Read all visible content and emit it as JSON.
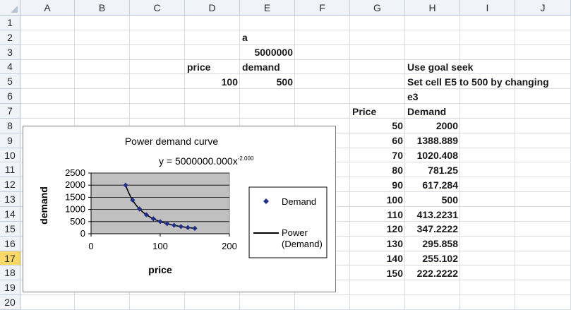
{
  "columns": [
    "A",
    "B",
    "C",
    "D",
    "E",
    "F",
    "G",
    "H",
    "I",
    "J"
  ],
  "rows": [
    "1",
    "2",
    "3",
    "4",
    "5",
    "6",
    "7",
    "8",
    "9",
    "10",
    "11",
    "12",
    "13",
    "14",
    "15",
    "16",
    "17",
    "18",
    "19",
    "20"
  ],
  "cells": {
    "E2": "a",
    "E3": "5000000",
    "D4": "price",
    "E4": "demand",
    "D5": "100",
    "E5": "500",
    "H4": "Use goal seek",
    "H5": "Set cell E5 to 500 by changing",
    "H6": "e3",
    "G7": "Price",
    "H7": "Demand"
  },
  "table": {
    "prices": [
      "50",
      "60",
      "70",
      "80",
      "90",
      "100",
      "110",
      "120",
      "130",
      "140",
      "150"
    ],
    "demands": [
      "2000",
      "1388.889",
      "1020.408",
      "781.25",
      "617.284",
      "500",
      "413.2231",
      "347.2222",
      "295.858",
      "255.102",
      "222.2222"
    ]
  },
  "chart_data": {
    "type": "scatter",
    "title": "Power demand curve",
    "equation_base": "y = 5000000.000x",
    "equation_exp": "-2.000",
    "xlabel": "price",
    "ylabel": "demand",
    "xlim": [
      0,
      200
    ],
    "ylim": [
      0,
      2500
    ],
    "x_ticks": [
      "0",
      "100",
      "200"
    ],
    "y_ticks": [
      "0",
      "500",
      "1000",
      "1500",
      "2000",
      "2500"
    ],
    "grid": true,
    "plot_background": "#c0c0c0",
    "marker_color": "#1f2f8a",
    "legend": {
      "position": "right",
      "entries": [
        {
          "label": "Demand",
          "kind": "marker"
        },
        {
          "label": "Power",
          "label2": "(Demand)",
          "kind": "line"
        }
      ]
    },
    "series": [
      {
        "kind": "points",
        "x": [
          50,
          60,
          70,
          80,
          90,
          100,
          110,
          120,
          130,
          140,
          150
        ],
        "y": [
          2000,
          1388.889,
          1020.408,
          781.25,
          617.284,
          500,
          413.2231,
          347.2222,
          295.858,
          255.102,
          222.2222
        ]
      }
    ],
    "trend": {
      "a": 5000000,
      "b": -2,
      "x_from": 50,
      "x_to": 150
    }
  },
  "selected_row": "17"
}
